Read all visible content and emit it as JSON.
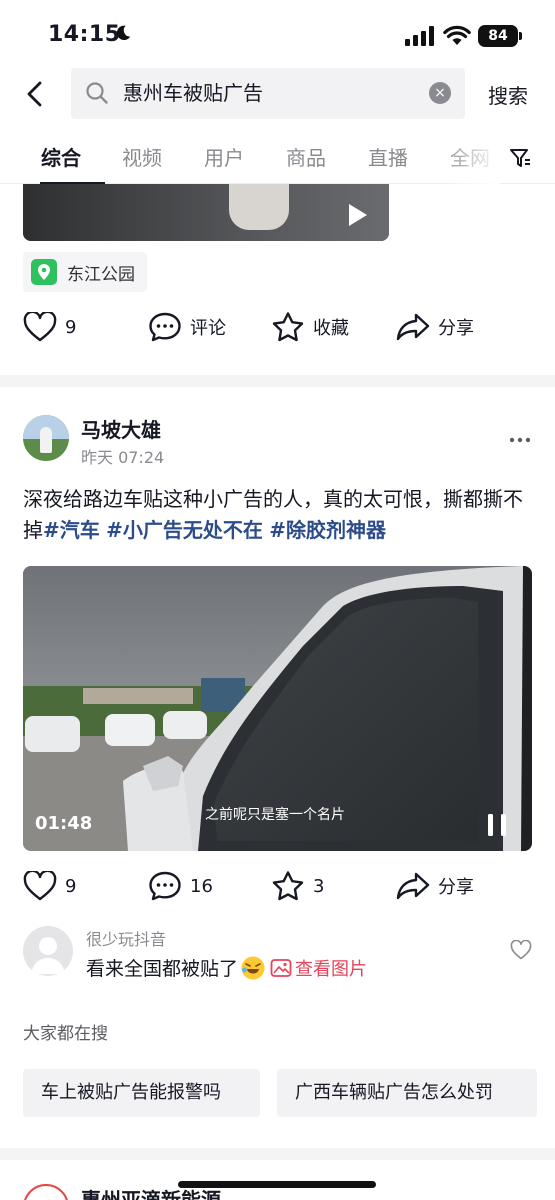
{
  "status_bar": {
    "time": "14:15",
    "battery": "84"
  },
  "search": {
    "query": "惠州车被贴广告",
    "clear_label": "×",
    "button_label": "搜索"
  },
  "tabs": [
    "综合",
    "视频",
    "用户",
    "商品",
    "直播",
    "全网"
  ],
  "previous_post": {
    "location": "东江公园",
    "actions": {
      "likes": "9",
      "comment_label": "评论",
      "favorite_label": "收藏",
      "share_label": "分享"
    }
  },
  "post": {
    "author": "马坡大雄",
    "time": "昨天 07:24",
    "text": "深夜给路边车贴这种小广告的人，真的太可恨，撕都撕不掉",
    "hashtags": [
      "#汽车",
      "#小广告无处不在",
      "#除胶剂神器"
    ],
    "video": {
      "duration": "01:48",
      "subtitle": "之前呢只是塞一个名片"
    },
    "actions": {
      "likes": "9",
      "comments": "16",
      "favorites": "3",
      "share_label": "分享"
    },
    "top_comment": {
      "user": "很少玩抖音",
      "text": "看来全国都被贴了",
      "view_image_label": "查看图片"
    }
  },
  "everyone_searching": {
    "title": "大家都在搜",
    "items": [
      "车上被贴广告能报警吗",
      "广西车辆贴广告怎么处罚"
    ]
  },
  "next_post": {
    "author": "惠州亚滴新能源"
  }
}
